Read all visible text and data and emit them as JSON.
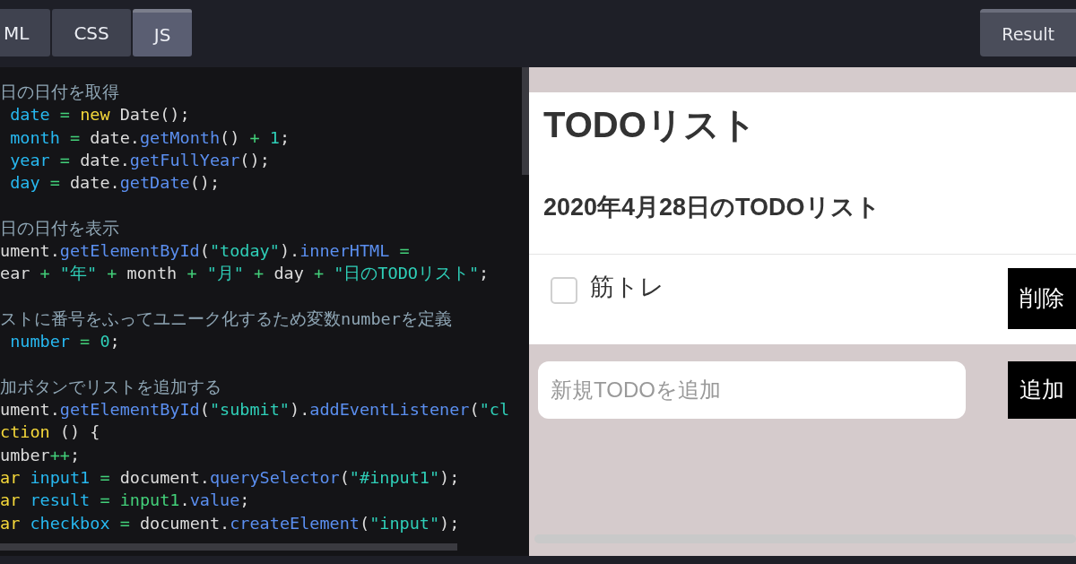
{
  "tabs": [
    {
      "label": "ML",
      "selected": false
    },
    {
      "label": "CSS",
      "selected": false
    },
    {
      "label": "JS",
      "selected": true
    }
  ],
  "result_button": {
    "label": "Result"
  },
  "code_lines": [
    {
      "kind": "code",
      "tokens": [
        {
          "kind": "comment",
          "text": "日の日付を取得"
        }
      ]
    },
    {
      "kind": "code",
      "tokens": [
        {
          "kind": "var",
          "text": " date"
        },
        {
          "kind": "op",
          "text": " = "
        },
        {
          "kind": "keyword",
          "text": "new"
        },
        {
          "kind": "plain",
          "text": " Date();"
        }
      ]
    },
    {
      "kind": "code",
      "tokens": [
        {
          "kind": "var",
          "text": " month"
        },
        {
          "kind": "op",
          "text": " = "
        },
        {
          "kind": "plain",
          "text": "date."
        },
        {
          "kind": "method",
          "text": "getMonth"
        },
        {
          "kind": "plain",
          "text": "()"
        },
        {
          "kind": "op",
          "text": " + "
        },
        {
          "kind": "number",
          "text": "1"
        },
        {
          "kind": "plain",
          "text": ";"
        }
      ]
    },
    {
      "kind": "code",
      "tokens": [
        {
          "kind": "var",
          "text": " year"
        },
        {
          "kind": "op",
          "text": " = "
        },
        {
          "kind": "plain",
          "text": "date."
        },
        {
          "kind": "method",
          "text": "getFullYear"
        },
        {
          "kind": "plain",
          "text": "();"
        }
      ]
    },
    {
      "kind": "code",
      "tokens": [
        {
          "kind": "var",
          "text": " day"
        },
        {
          "kind": "op",
          "text": " = "
        },
        {
          "kind": "plain",
          "text": "date."
        },
        {
          "kind": "method",
          "text": "getDate"
        },
        {
          "kind": "plain",
          "text": "();"
        }
      ]
    },
    {
      "kind": "blank"
    },
    {
      "kind": "code",
      "tokens": [
        {
          "kind": "comment",
          "text": "日の日付を表示"
        }
      ]
    },
    {
      "kind": "code",
      "tokens": [
        {
          "kind": "plain",
          "text": "ument."
        },
        {
          "kind": "method",
          "text": "getElementById"
        },
        {
          "kind": "plain",
          "text": "("
        },
        {
          "kind": "string",
          "text": "\"today\""
        },
        {
          "kind": "plain",
          "text": ")."
        },
        {
          "kind": "method",
          "text": "innerHTML"
        },
        {
          "kind": "op",
          "text": " ="
        }
      ]
    },
    {
      "kind": "code",
      "tokens": [
        {
          "kind": "plain",
          "text": "ear"
        },
        {
          "kind": "op",
          "text": " + "
        },
        {
          "kind": "string",
          "text": "\"年\""
        },
        {
          "kind": "op",
          "text": " + "
        },
        {
          "kind": "plain",
          "text": "month"
        },
        {
          "kind": "op",
          "text": " + "
        },
        {
          "kind": "string",
          "text": "\"月\""
        },
        {
          "kind": "op",
          "text": " + "
        },
        {
          "kind": "plain",
          "text": "day"
        },
        {
          "kind": "op",
          "text": " + "
        },
        {
          "kind": "string",
          "text": "\"日のTODOリスト\""
        },
        {
          "kind": "plain",
          "text": ";"
        }
      ]
    },
    {
      "kind": "blank"
    },
    {
      "kind": "code",
      "tokens": [
        {
          "kind": "comment",
          "text": "ストに番号をふってユニーク化するため変数numberを定義"
        }
      ]
    },
    {
      "kind": "code",
      "tokens": [
        {
          "kind": "var",
          "text": " number"
        },
        {
          "kind": "op",
          "text": " = "
        },
        {
          "kind": "number",
          "text": "0"
        },
        {
          "kind": "plain",
          "text": ";"
        }
      ]
    },
    {
      "kind": "blank"
    },
    {
      "kind": "code",
      "tokens": [
        {
          "kind": "comment",
          "text": "加ボタンでリストを追加する"
        }
      ]
    },
    {
      "kind": "code",
      "tokens": [
        {
          "kind": "plain",
          "text": "ument."
        },
        {
          "kind": "method",
          "text": "getElementById"
        },
        {
          "kind": "plain",
          "text": "("
        },
        {
          "kind": "string",
          "text": "\"submit\""
        },
        {
          "kind": "plain",
          "text": ")."
        },
        {
          "kind": "method",
          "text": "addEventListener"
        },
        {
          "kind": "plain",
          "text": "("
        },
        {
          "kind": "string",
          "text": "\"cl"
        }
      ]
    },
    {
      "kind": "code",
      "tokens": [
        {
          "kind": "keyword",
          "text": "ction"
        },
        {
          "kind": "plain",
          "text": " () {"
        }
      ]
    },
    {
      "kind": "code",
      "tokens": [
        {
          "kind": "plain",
          "text": "umber"
        },
        {
          "kind": "op",
          "text": "++"
        },
        {
          "kind": "plain",
          "text": ";"
        }
      ]
    },
    {
      "kind": "code",
      "tokens": [
        {
          "kind": "keyword",
          "text": "ar"
        },
        {
          "kind": "var",
          "text": " input1"
        },
        {
          "kind": "op",
          "text": " = "
        },
        {
          "kind": "plain",
          "text": "document."
        },
        {
          "kind": "method",
          "text": "querySelector"
        },
        {
          "kind": "plain",
          "text": "("
        },
        {
          "kind": "string",
          "text": "\"#input1\""
        },
        {
          "kind": "plain",
          "text": ");"
        }
      ]
    },
    {
      "kind": "code",
      "tokens": [
        {
          "kind": "keyword",
          "text": "ar"
        },
        {
          "kind": "var",
          "text": " result"
        },
        {
          "kind": "op",
          "text": " = "
        },
        {
          "kind": "op",
          "text": "input1"
        },
        {
          "kind": "plain",
          "text": "."
        },
        {
          "kind": "method",
          "text": "value"
        },
        {
          "kind": "plain",
          "text": ";"
        }
      ]
    },
    {
      "kind": "code",
      "tokens": [
        {
          "kind": "keyword",
          "text": "ar"
        },
        {
          "kind": "var",
          "text": " checkbox"
        },
        {
          "kind": "op",
          "text": " = "
        },
        {
          "kind": "plain",
          "text": "document."
        },
        {
          "kind": "method",
          "text": "createElement"
        },
        {
          "kind": "plain",
          "text": "("
        },
        {
          "kind": "string",
          "text": "\"input\""
        },
        {
          "kind": "plain",
          "text": ");"
        }
      ]
    }
  ],
  "preview": {
    "title": "TODOリスト",
    "date_heading": "2020年4月28日のTODOリスト",
    "todos": [
      {
        "text": "筋トレ",
        "checked": false,
        "delete_label": "削除"
      }
    ],
    "new_todo": {
      "placeholder": "新規TODOを追加",
      "add_label": "追加"
    }
  }
}
